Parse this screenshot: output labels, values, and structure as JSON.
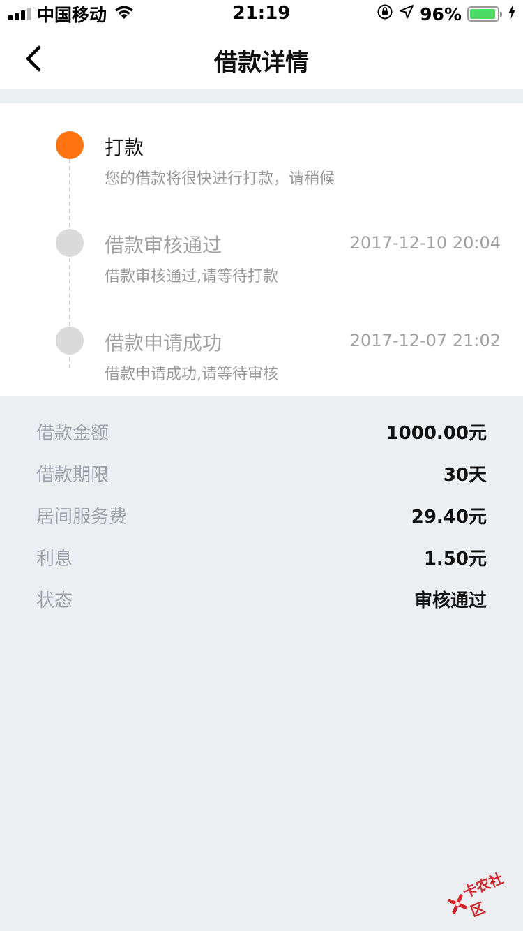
{
  "status_bar": {
    "carrier": "中国移动",
    "time": "21:19",
    "battery_percent": "96%",
    "battery_level": 0.96,
    "icons": [
      "signal-icon",
      "wifi-icon",
      "orientation-lock-icon",
      "location-arrow-icon",
      "battery-icon",
      "charging-icon"
    ]
  },
  "nav": {
    "title": "借款详情",
    "back_icon": "chevron-left-icon"
  },
  "timeline": [
    {
      "title": "打款",
      "time": "",
      "desc": "您的借款将很快进行打款，请稍候",
      "active": true
    },
    {
      "title": "借款审核通过",
      "time": "2017-12-10 20:04",
      "desc": "借款审核通过,请等待打款",
      "active": false
    },
    {
      "title": "借款申请成功",
      "time": "2017-12-07 21:02",
      "desc": "借款申请成功,请等待审核",
      "active": false
    }
  ],
  "details": [
    {
      "label": "借款金额",
      "value": "1000.00元"
    },
    {
      "label": "借款期限",
      "value": "30天"
    },
    {
      "label": "居间服务费",
      "value": "29.40元"
    },
    {
      "label": "利息",
      "value": "1.50元"
    },
    {
      "label": "状态",
      "value": "审核通过"
    }
  ],
  "watermark": {
    "text": "卡农社区"
  },
  "colors": {
    "accent": "#ff7310",
    "inactive_dot": "#dadada",
    "background": "#eceff1",
    "label_gray": "#9ea3ad",
    "battery_green": "#4cd964"
  }
}
